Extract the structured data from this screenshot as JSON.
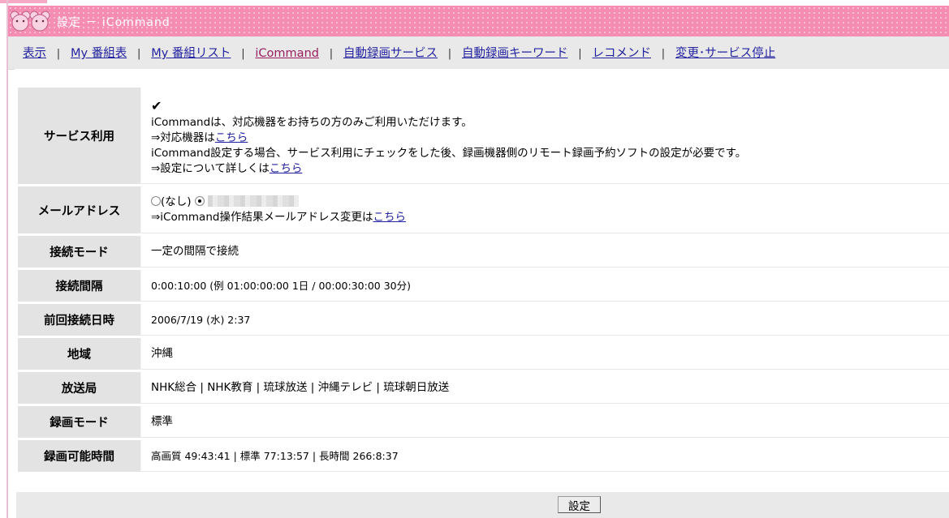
{
  "header": {
    "title": "設定 － iCommand",
    "logo_icon": "pink-bear-logo-icon"
  },
  "nav": {
    "items": [
      {
        "label": "表示"
      },
      {
        "label": "My 番組表"
      },
      {
        "label": "My 番組リスト"
      },
      {
        "label": "iCommand"
      },
      {
        "label": "自動録画サービス"
      },
      {
        "label": "自動録画キーワード"
      },
      {
        "label": "レコメンド"
      },
      {
        "label": "変更･サービス停止"
      }
    ],
    "separator": "|",
    "active_index": 3
  },
  "settings": {
    "service": {
      "label": "サービス利用",
      "checked": true,
      "line1": "iCommandは、対応機器をお持ちの方のみご利用いただけます。",
      "line2_prefix": "⇒対応機器は",
      "line2_link": "こちら",
      "line3": "iCommand設定する場合、サービス利用にチェックをした後、録画機器側のリモート録画予約ソフトの設定が必要です。",
      "line4_prefix": "⇒設定について詳しくは",
      "line4_link": "こちら"
    },
    "mail": {
      "label": "メールアドレス",
      "option_none": "(なし)",
      "line2_prefix": "⇒iCommand操作結果メールアドレス変更は",
      "line2_link": "こちら"
    },
    "connect_mode": {
      "label": "接続モード",
      "value": "一定の間隔で接続"
    },
    "connect_interval": {
      "label": "接続間隔",
      "value": "0:00:10:00 (例 01:00:00:00 1日 / 00:00:30:00 30分)"
    },
    "last_connect": {
      "label": "前回接続日時",
      "value": "2006/7/19 (水) 2:37"
    },
    "region": {
      "label": "地域",
      "value": "沖縄"
    },
    "stations": {
      "label": "放送局",
      "value": "NHK総合 | NHK教育 | 琉球放送 | 沖縄テレビ | 琉球朝日放送"
    },
    "record_mode": {
      "label": "録画モード",
      "value": "標準"
    },
    "record_time": {
      "label": "録画可能時間",
      "value": "高画質 49:43:41 | 標準 77:13:57 | 長時間 266:8:37"
    }
  },
  "footer": {
    "submit_label": "設定"
  },
  "colors": {
    "title_bar": "#f58cb2",
    "nav_bg": "#e9e9e9",
    "link": "#2222a0",
    "active_link": "#9b1e5e",
    "label_bg": "#e3e3e3"
  }
}
